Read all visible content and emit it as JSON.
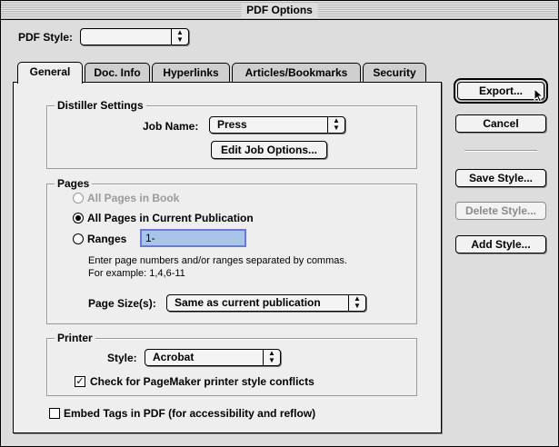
{
  "window": {
    "title": "PDF Options"
  },
  "pdf_style": {
    "label": "PDF Style:",
    "value": ""
  },
  "tabs": [
    {
      "label": "General",
      "active": true
    },
    {
      "label": "Doc. Info",
      "active": false
    },
    {
      "label": "Hyperlinks",
      "active": false
    },
    {
      "label": "Articles/Bookmarks",
      "active": false
    },
    {
      "label": "Security",
      "active": false
    }
  ],
  "distiller": {
    "title": "Distiller Settings",
    "job_name_label": "Job Name:",
    "job_name_value": "Press",
    "edit_button": "Edit Job Options..."
  },
  "pages": {
    "title": "Pages",
    "all_in_book": "All Pages in Book",
    "all_in_publication": "All Pages in Current Publication",
    "ranges_label": "Ranges",
    "ranges_value": "1-",
    "hint_line1": "Enter page numbers and/or ranges separated by commas.",
    "hint_line2": "For example: 1,4,6-11",
    "page_size_label": "Page Size(s):",
    "page_size_value": "Same as current publication"
  },
  "printer": {
    "title": "Printer",
    "style_label": "Style:",
    "style_value": "Acrobat",
    "check_conflicts": "Check for PageMaker printer style conflicts"
  },
  "embed_tags": "Embed Tags in PDF (for accessibility and reflow)",
  "buttons": {
    "export": "Export...",
    "cancel": "Cancel",
    "save_style": "Save Style...",
    "delete_style": "Delete Style...",
    "add_style": "Add Style..."
  }
}
